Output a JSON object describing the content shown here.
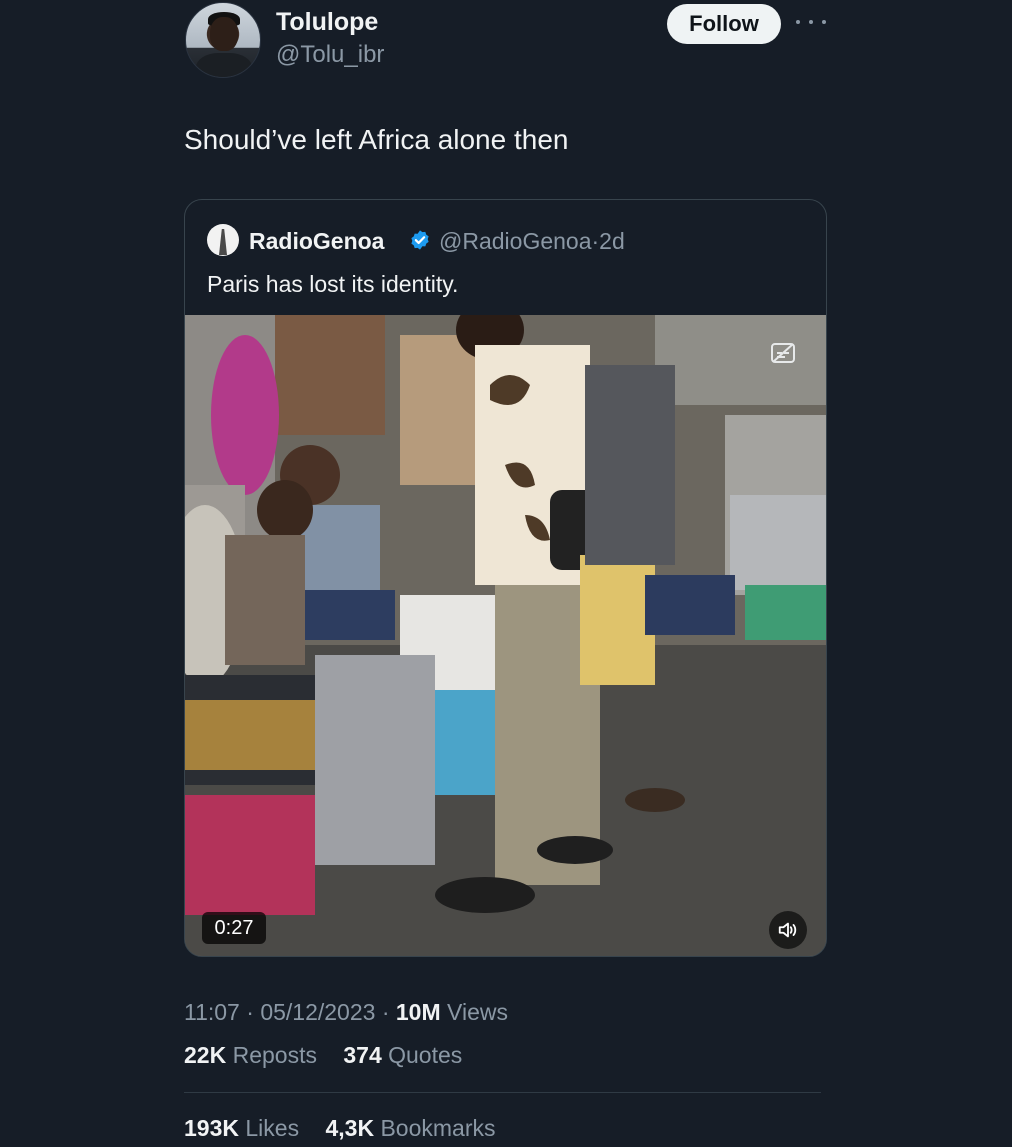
{
  "tweet": {
    "display_name": "Tolulope",
    "handle": "@Tolu_ibr",
    "follow_label": "Follow",
    "text": "Should’ve left Africa alone then"
  },
  "quote": {
    "display_name": "RadioGenoa",
    "handle": "@RadioGenoa",
    "separator": "·",
    "age": "2d",
    "text": "Paris has lost its identity.",
    "video_duration": "0:27"
  },
  "meta": {
    "time": "11:07",
    "dot": "·",
    "date": "05/12/2023",
    "views_value": "10M",
    "views_label": "Views"
  },
  "engagement": {
    "reposts_value": "22K",
    "reposts_label": "Reposts",
    "quotes_value": "374",
    "quotes_label": "Quotes",
    "likes_value": "193K",
    "likes_label": "Likes",
    "bookmarks_value": "4,3K",
    "bookmarks_label": "Bookmarks"
  },
  "colors": {
    "background": "#161d27",
    "verified": "#1d9bf0",
    "follow_button": "#eff3f4"
  },
  "icons": [
    "more-icon",
    "verified-icon",
    "caption-icon",
    "speaker-icon"
  ]
}
